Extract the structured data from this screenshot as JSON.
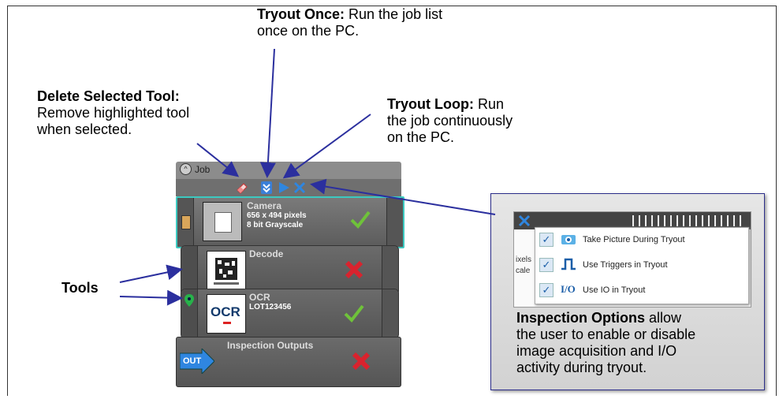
{
  "annotations": {
    "tryout_once": {
      "title": "Tryout Once:",
      "line1": "Run the job list",
      "line2": "once on the PC."
    },
    "delete_tool": {
      "title": "Delete Selected Tool:",
      "line1": "Remove highlighted tool",
      "line2": "when selected."
    },
    "tryout_loop": {
      "title": "Tryout Loop:",
      "line1": "Run",
      "line2": "the job continuously",
      "line3": "on the PC."
    },
    "tools": {
      "label": "Tools"
    }
  },
  "job_panel": {
    "title": "Job",
    "tools": [
      {
        "name": "Camera",
        "info1": "656 x 494 pixels",
        "info2": "8 bit Grayscale",
        "status": "pass"
      },
      {
        "name": "Decode",
        "status": "fail"
      },
      {
        "name": "OCR",
        "info1": "LOT123456",
        "status": "pass"
      },
      {
        "name": "Inspection Outputs",
        "status": "fail"
      }
    ],
    "thumb_labels": {
      "ocr": "OCR",
      "out": "OUT"
    }
  },
  "inspection_options": {
    "menu": [
      {
        "label": "Take Picture During Tryout",
        "checked": true,
        "icon": "camera-icon"
      },
      {
        "label": "Use Triggers in Tryout",
        "checked": true,
        "icon": "trigger-pulse-icon"
      },
      {
        "label": "Use IO in Tryout",
        "checked": true,
        "icon": "io-icon",
        "icon_text": "I/O"
      }
    ],
    "bg_fragments": {
      "f1": "ixels",
      "f2": "cale"
    },
    "description_bold": "Inspection Options",
    "description_l1": " allow",
    "description_l2": "the user to enable or disable",
    "description_l3": "image acquisition and I/O",
    "description_l4": "activity during tryout."
  },
  "colors": {
    "arrow": "#2b2f9e",
    "selected": "#3cc9c0",
    "pass": "#6fc23a",
    "fail": "#d9232e"
  }
}
